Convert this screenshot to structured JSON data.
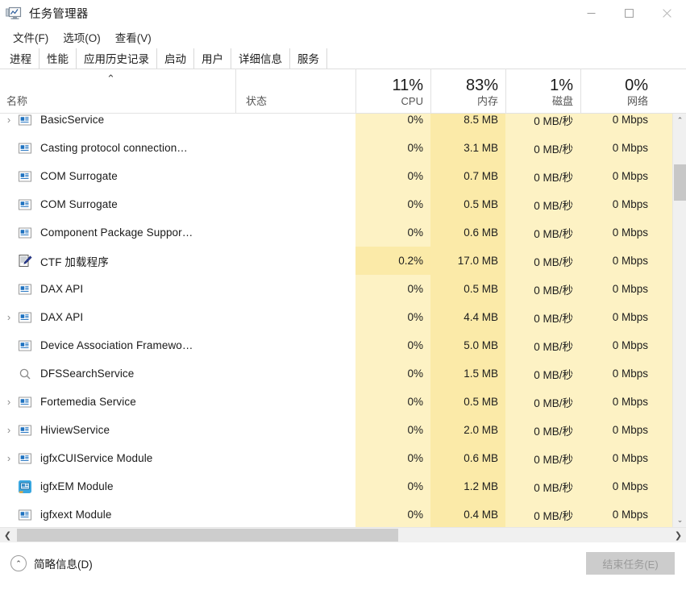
{
  "window": {
    "title": "任务管理器",
    "app_icon": "task-manager-monitor-icon",
    "minimize": "—",
    "maximize": "□",
    "close": "✕"
  },
  "menubar": [
    {
      "label": "文件(F)"
    },
    {
      "label": "选项(O)"
    },
    {
      "label": "查看(V)"
    }
  ],
  "tabs": [
    {
      "label": "进程",
      "active": true
    },
    {
      "label": "性能",
      "active": false
    },
    {
      "label": "应用历史记录",
      "active": false
    },
    {
      "label": "启动",
      "active": false
    },
    {
      "label": "用户",
      "active": false
    },
    {
      "label": "详细信息",
      "active": false
    },
    {
      "label": "服务",
      "active": false
    }
  ],
  "columns": {
    "name": {
      "label": "名称",
      "pct": ""
    },
    "status": {
      "label": "状态",
      "pct": ""
    },
    "cpu": {
      "label": "CPU",
      "pct": "11%"
    },
    "memory": {
      "label": "内存",
      "pct": "83%"
    },
    "disk": {
      "label": "磁盘",
      "pct": "1%"
    },
    "network": {
      "label": "网络",
      "pct": "0%"
    },
    "sort_caret": "⌃"
  },
  "processes": [
    {
      "name": "BasicService",
      "icon": "service-window-icon",
      "expander": "›",
      "cpu": "0%",
      "memory": "8.5 MB",
      "disk": "0 MB/秒",
      "network": "0 Mbps",
      "cpu_hot": false
    },
    {
      "name": "Casting protocol connection…",
      "icon": "service-window-icon",
      "expander": "",
      "cpu": "0%",
      "memory": "3.1 MB",
      "disk": "0 MB/秒",
      "network": "0 Mbps",
      "cpu_hot": false
    },
    {
      "name": "COM Surrogate",
      "icon": "service-window-icon",
      "expander": "",
      "cpu": "0%",
      "memory": "0.7 MB",
      "disk": "0 MB/秒",
      "network": "0 Mbps",
      "cpu_hot": false
    },
    {
      "name": "COM Surrogate",
      "icon": "service-window-icon",
      "expander": "",
      "cpu": "0%",
      "memory": "0.5 MB",
      "disk": "0 MB/秒",
      "network": "0 Mbps",
      "cpu_hot": false
    },
    {
      "name": "Component Package Suppor…",
      "icon": "service-window-icon",
      "expander": "",
      "cpu": "0%",
      "memory": "0.6 MB",
      "disk": "0 MB/秒",
      "network": "0 Mbps",
      "cpu_hot": false
    },
    {
      "name": "CTF 加载程序",
      "icon": "pen-notepad-icon",
      "expander": "",
      "cpu": "0.2%",
      "memory": "17.0 MB",
      "disk": "0 MB/秒",
      "network": "0 Mbps",
      "cpu_hot": true
    },
    {
      "name": "DAX API",
      "icon": "service-window-icon",
      "expander": "",
      "cpu": "0%",
      "memory": "0.5 MB",
      "disk": "0 MB/秒",
      "network": "0 Mbps",
      "cpu_hot": false
    },
    {
      "name": "DAX API",
      "icon": "service-window-icon",
      "expander": "›",
      "cpu": "0%",
      "memory": "4.4 MB",
      "disk": "0 MB/秒",
      "network": "0 Mbps",
      "cpu_hot": false
    },
    {
      "name": "Device Association Framewo…",
      "icon": "service-window-icon",
      "expander": "",
      "cpu": "0%",
      "memory": "5.0 MB",
      "disk": "0 MB/秒",
      "network": "0 Mbps",
      "cpu_hot": false
    },
    {
      "name": "DFSSearchService",
      "icon": "magnifier-icon",
      "expander": "",
      "cpu": "0%",
      "memory": "1.5 MB",
      "disk": "0 MB/秒",
      "network": "0 Mbps",
      "cpu_hot": false
    },
    {
      "name": "Fortemedia Service",
      "icon": "service-window-icon",
      "expander": "›",
      "cpu": "0%",
      "memory": "0.5 MB",
      "disk": "0 MB/秒",
      "network": "0 Mbps",
      "cpu_hot": false
    },
    {
      "name": "HiviewService",
      "icon": "service-window-icon",
      "expander": "›",
      "cpu": "0%",
      "memory": "2.0 MB",
      "disk": "0 MB/秒",
      "network": "0 Mbps",
      "cpu_hot": false
    },
    {
      "name": "igfxCUIService Module",
      "icon": "service-window-icon",
      "expander": "›",
      "cpu": "0%",
      "memory": "0.6 MB",
      "disk": "0 MB/秒",
      "network": "0 Mbps",
      "cpu_hot": false
    },
    {
      "name": "igfxEM Module",
      "icon": "intel-graphics-icon",
      "expander": "",
      "cpu": "0%",
      "memory": "1.2 MB",
      "disk": "0 MB/秒",
      "network": "0 Mbps",
      "cpu_hot": false
    },
    {
      "name": "igfxext Module",
      "icon": "service-window-icon",
      "expander": "",
      "cpu": "0%",
      "memory": "0.4 MB",
      "disk": "0 MB/秒",
      "network": "0 Mbps",
      "cpu_hot": false
    }
  ],
  "scrollbars": {
    "v_up": "⌃",
    "v_down": "⌄",
    "h_left": "❮",
    "h_right": "❯"
  },
  "statusbar": {
    "fewer_details_label": "简略信息(D)",
    "fewer_details_chevron": "⌃",
    "end_task_label": "结束任务(E)"
  },
  "colors": {
    "cpu_tint": "#fdf2c4",
    "cpu_hot_tint": "#fbeaa8",
    "memory_tint": "#fbeaa8",
    "disk_tint": "#fdf2c4",
    "network_tint": "#fdf2c4",
    "close_hover": "#e81123"
  }
}
